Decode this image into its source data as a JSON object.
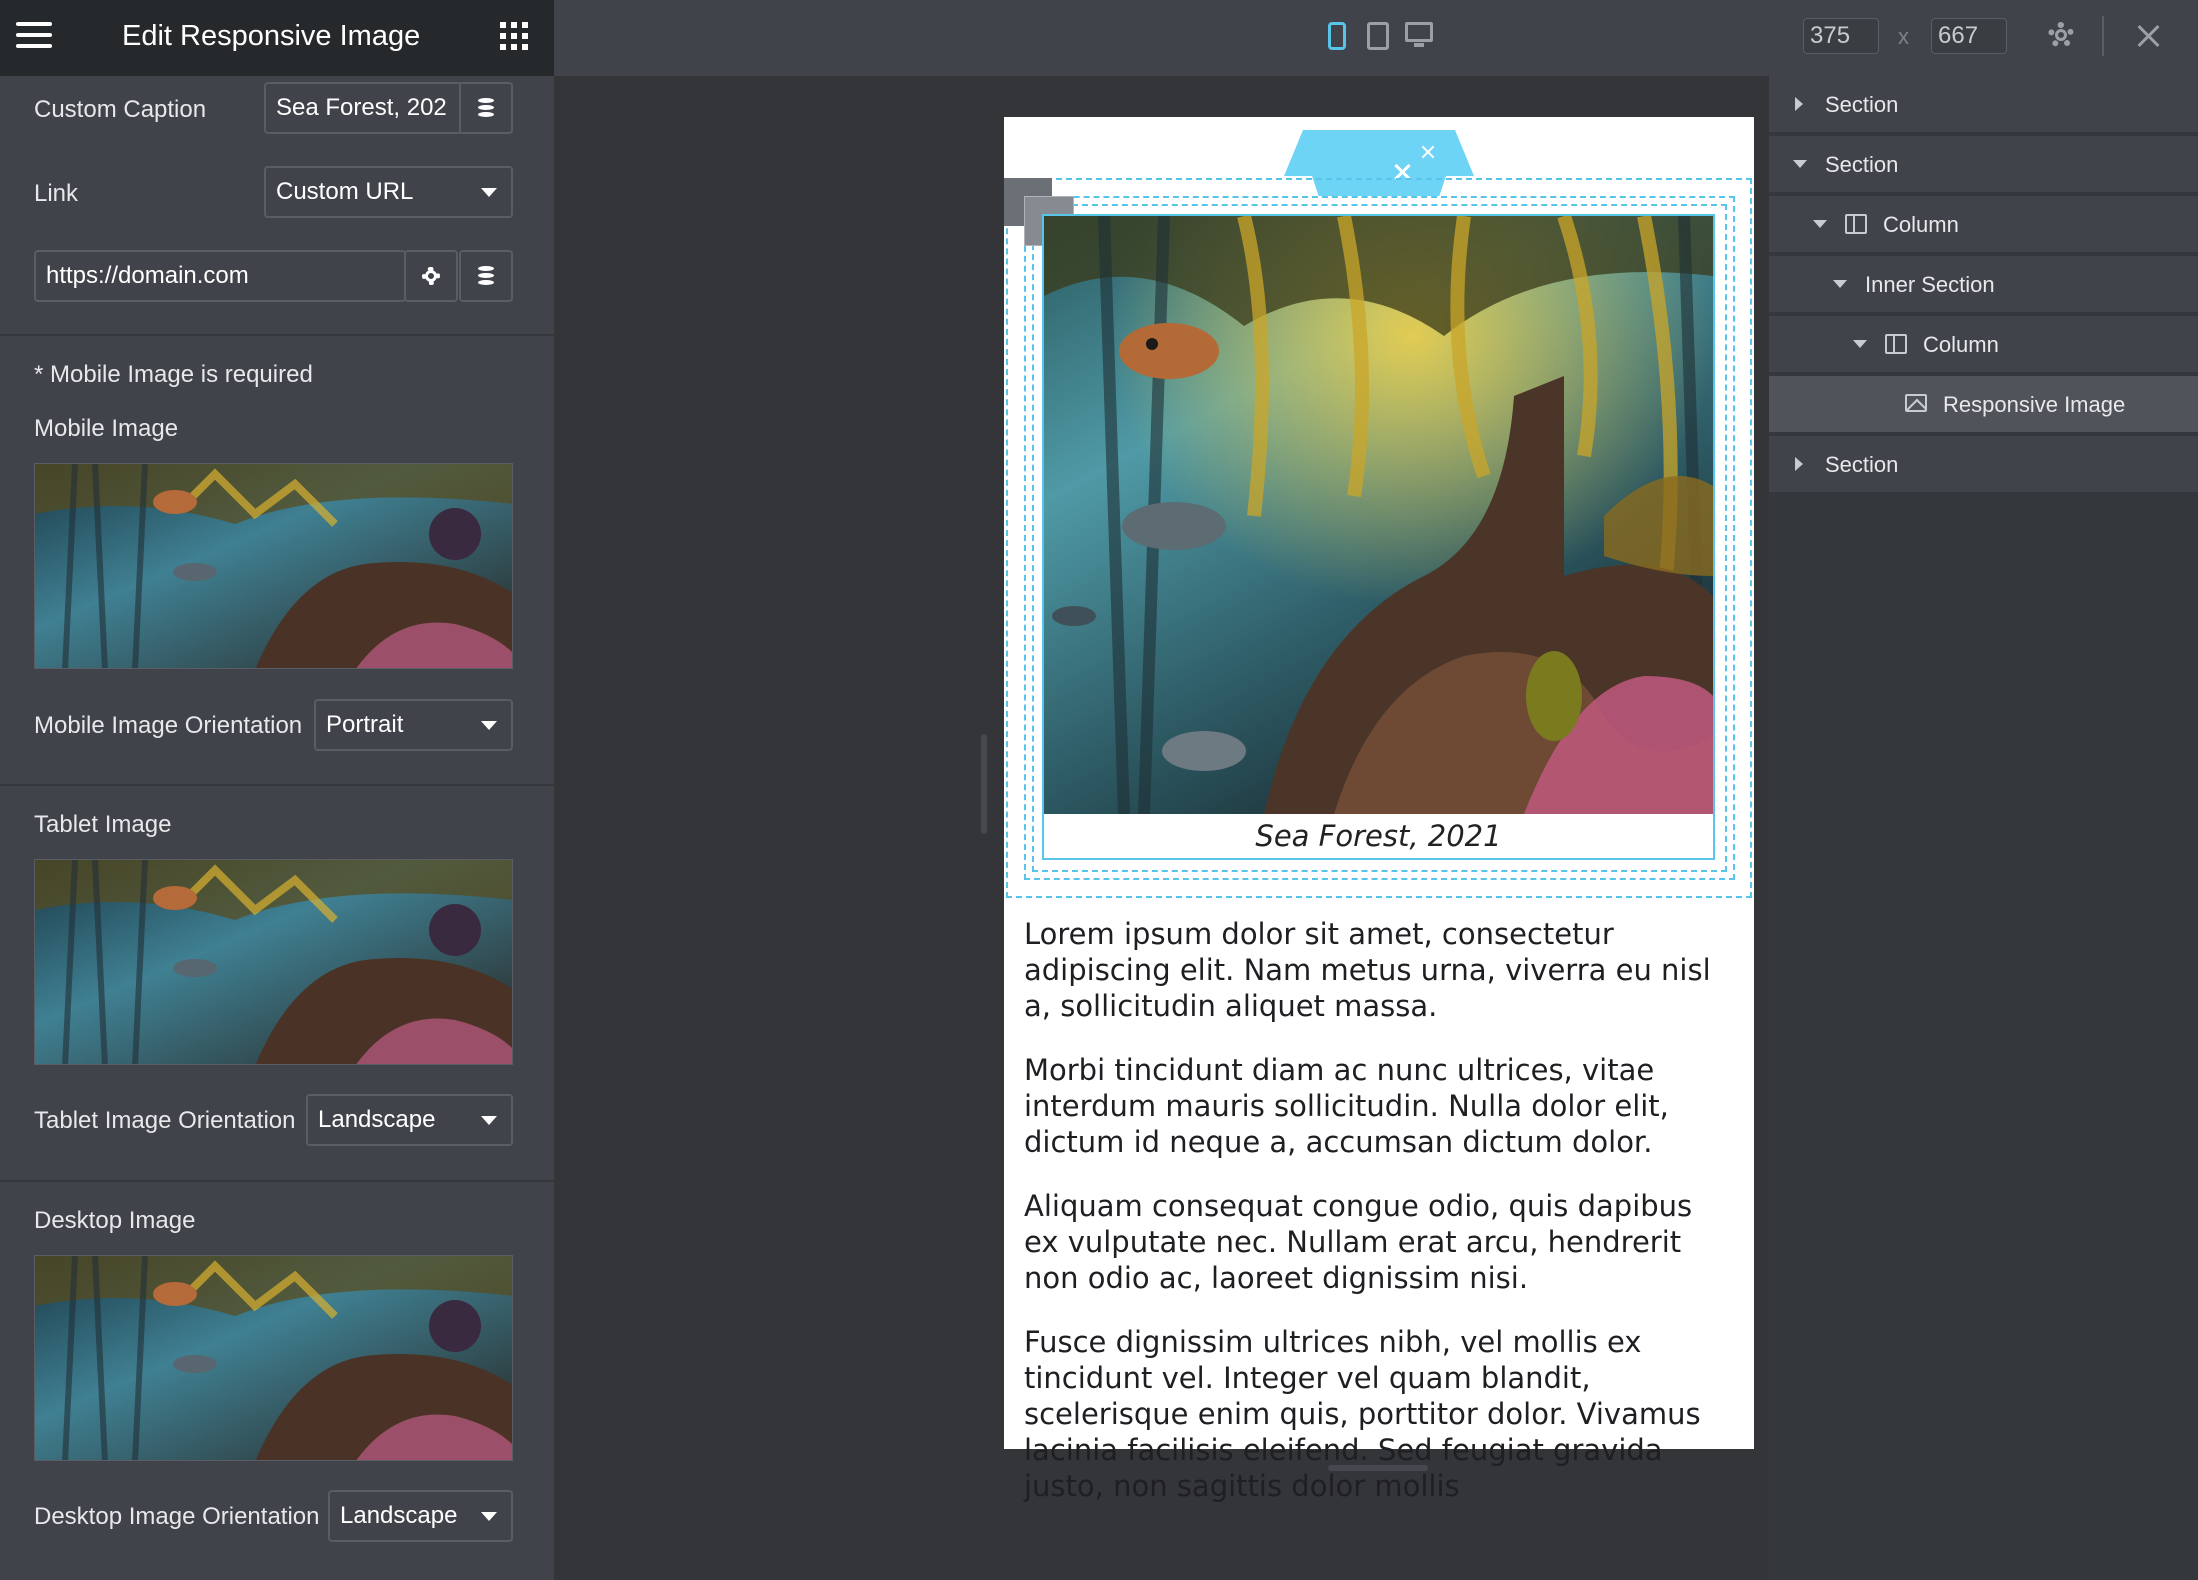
{
  "panel": {
    "title": "Edit Responsive Image",
    "custom_caption_label": "Custom Caption",
    "custom_caption_value": "Sea Forest, 202",
    "link_label": "Link",
    "link_value": "Custom URL",
    "url_value": "https://domain.com",
    "required_note": "* Mobile Image is required",
    "mobile_image_label": "Mobile Image",
    "mobile_orientation_label": "Mobile Image Orientation",
    "mobile_orientation_value": "Portrait",
    "tablet_image_label": "Tablet Image",
    "tablet_orientation_label": "Tablet Image Orientation",
    "tablet_orientation_value": "Landscape",
    "desktop_image_label": "Desktop Image",
    "desktop_orientation_label": "Desktop Image Orientation",
    "desktop_orientation_value": "Landscape"
  },
  "topbar": {
    "width_value": "375",
    "separator": "x",
    "height_value": "667",
    "active_device": "mobile"
  },
  "preview": {
    "caption": "Sea Forest, 2021",
    "paragraphs": [
      "Lorem ipsum dolor sit amet, consectetur adipiscing elit. Nam metus urna, viverra eu nisl a, sollicitudin aliquet massa.",
      "Morbi tincidunt diam ac nunc ultrices, vitae interdum mauris sollicitudin. Nulla dolor elit, dictum id neque a, accumsan dictum dolor.",
      "Aliquam consequat congue odio, quis dapibus ex vulputate nec. Nullam erat arcu, hendrerit non odio ac, laoreet dignissim nisi.",
      "Fusce dignissim ultrices nibh, vel mollis ex tincidunt vel. Integer vel quam blandit, scelerisque enim quis, porttitor dolor. Vivamus lacinia facilisis eleifend. Sed feugiat gravida justo, non sagittis dolor mollis"
    ]
  },
  "navigator": {
    "items": [
      {
        "label": "Section",
        "icon": "caret-right-icon"
      },
      {
        "label": "Section",
        "icon": "caret-down-icon"
      },
      {
        "label": "Column",
        "icon": "column-icon"
      },
      {
        "label": "Inner Section",
        "icon": "caret-down-icon"
      },
      {
        "label": "Column",
        "icon": "column-icon"
      },
      {
        "label": "Responsive Image",
        "icon": "image-icon"
      },
      {
        "label": "Section",
        "icon": "caret-right-icon"
      }
    ]
  },
  "colors": {
    "accent": "#58c4ea",
    "panel_bg": "#404349",
    "header_bg": "#26292c",
    "canvas_bg": "#333539"
  }
}
